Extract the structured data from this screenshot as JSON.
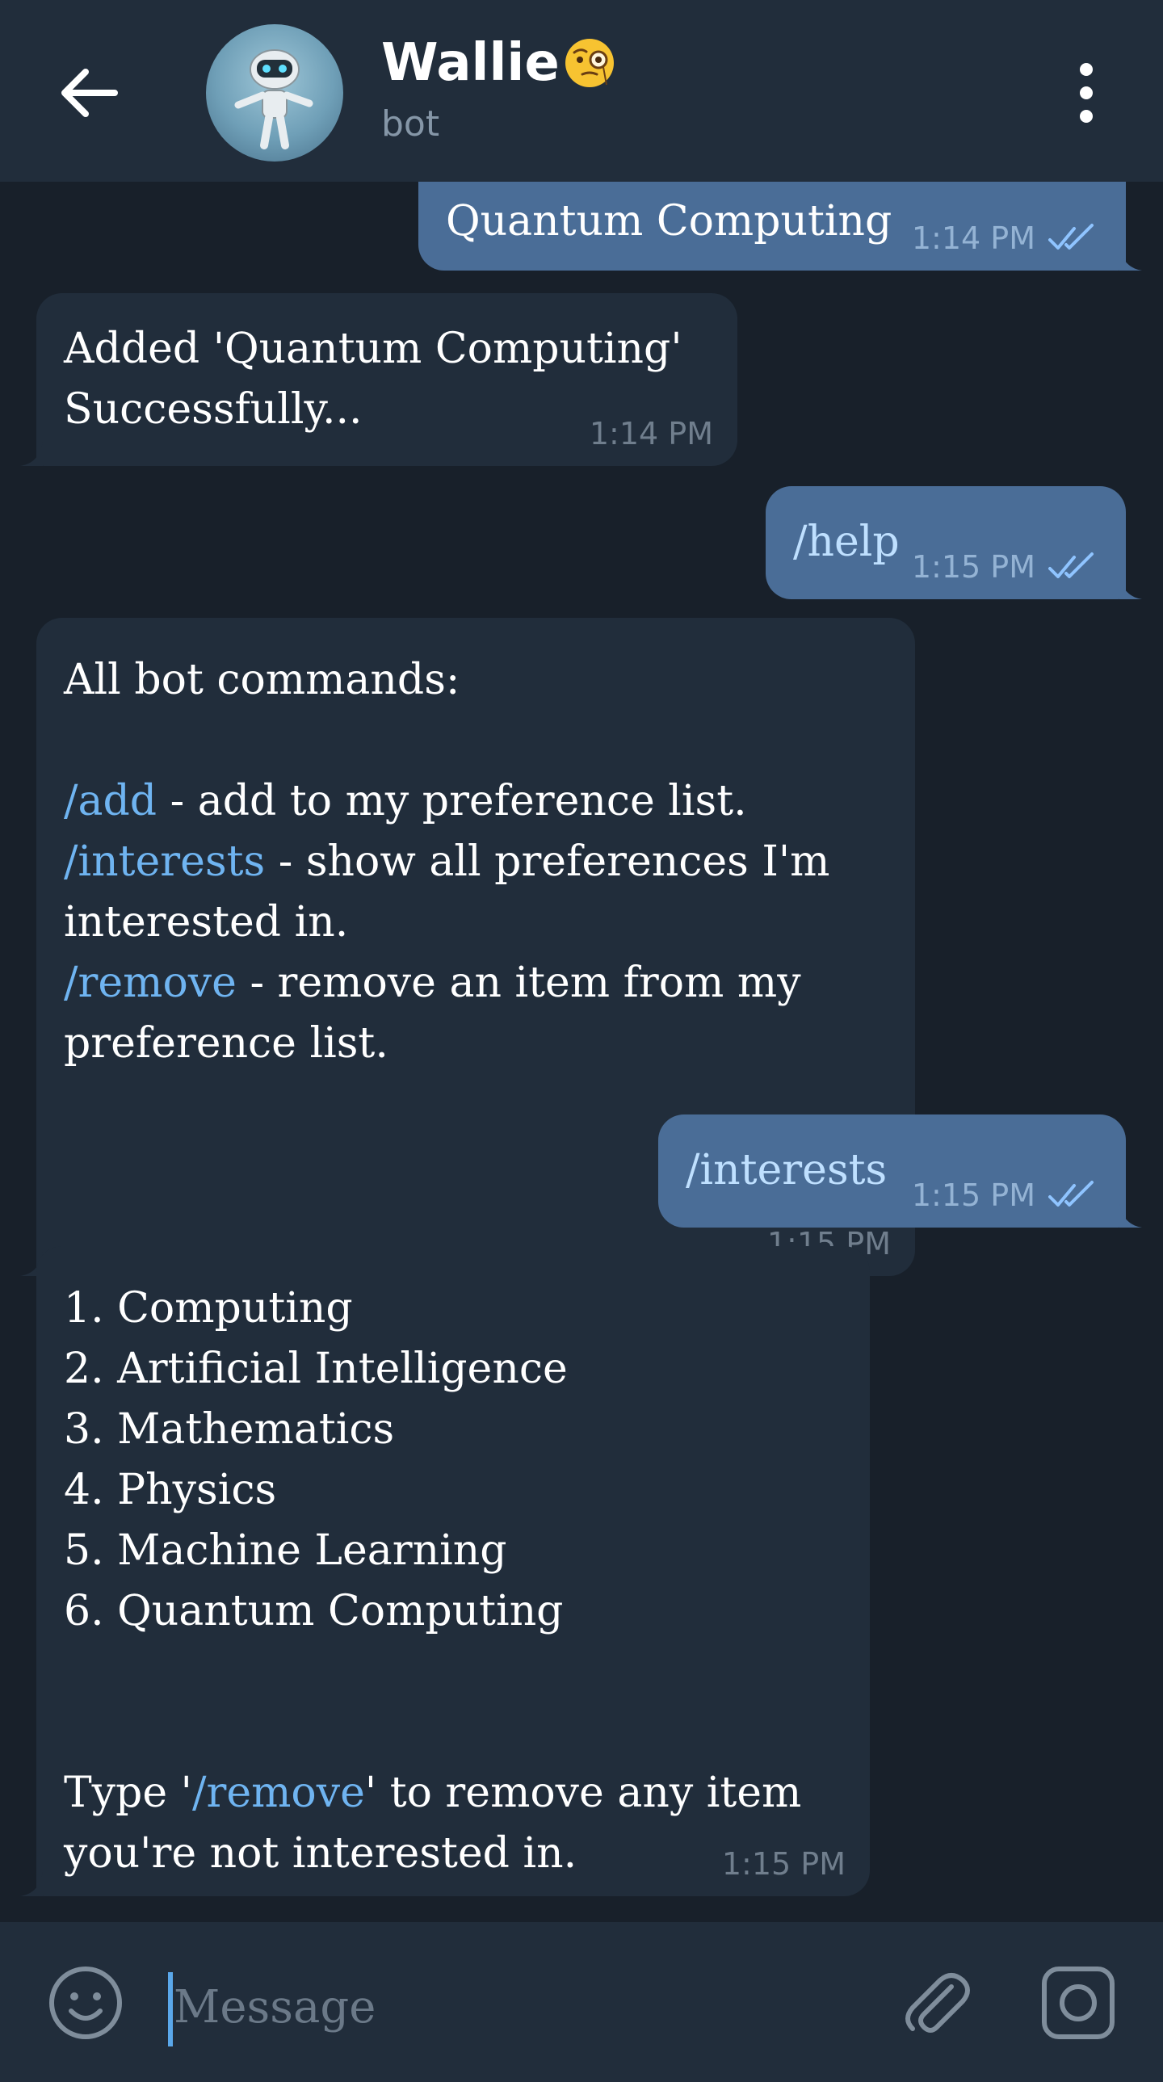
{
  "header": {
    "back_icon": "arrow-left-icon",
    "avatar_icon": "robot-avatar",
    "title": "Wallie",
    "title_emoji": "monocle-face-emoji",
    "subtitle": "bot",
    "menu_icon": "more-vertical-icon"
  },
  "messages": [
    {
      "direction": "out",
      "text": "Quantum Computing",
      "time": "1:14 PM",
      "status_icon": "double-check-icon"
    },
    {
      "direction": "in",
      "lines": [
        "Added 'Quantum Computing'",
        "Successfully..."
      ],
      "time": "1:14 PM"
    },
    {
      "direction": "out",
      "text": "/help",
      "time": "1:15 PM",
      "status_icon": "double-check-icon"
    },
    {
      "direction": "in",
      "header": "All bot commands:",
      "commands": [
        {
          "cmd": "/add",
          "desc": " - add to my preference list."
        },
        {
          "cmd": "/interests",
          "desc": " - show all preferences I'm",
          "desc_cont": "interested in."
        },
        {
          "cmd": "/remove",
          "desc": " - remove an item from my",
          "desc_cont": "preference list."
        }
      ],
      "time": "1:15 PM"
    },
    {
      "direction": "out",
      "text": "/interests",
      "time": "1:15 PM",
      "status_icon": "double-check-icon"
    },
    {
      "direction": "in",
      "list": [
        "1. Computing",
        "2. Artificial Intelligence",
        "3. Mathematics",
        "4. Physics",
        "5. Machine Learning",
        "6. Quantum Computing"
      ],
      "footer_pre": "Type '",
      "footer_cmd": "/remove",
      "footer_post": "' to remove any item",
      "footer_line2": "you're not interested in.",
      "time": "1:15 PM"
    }
  ],
  "input": {
    "placeholder": "Message",
    "emoji_icon": "smiley-icon",
    "attach_icon": "paperclip-icon",
    "camera_icon": "camera-icon"
  },
  "colors": {
    "background": "#18202a",
    "header": "#212d3b",
    "incoming_bubble": "#212d3b",
    "outgoing_bubble": "#4a6d97",
    "link": "#6fb4f1"
  }
}
